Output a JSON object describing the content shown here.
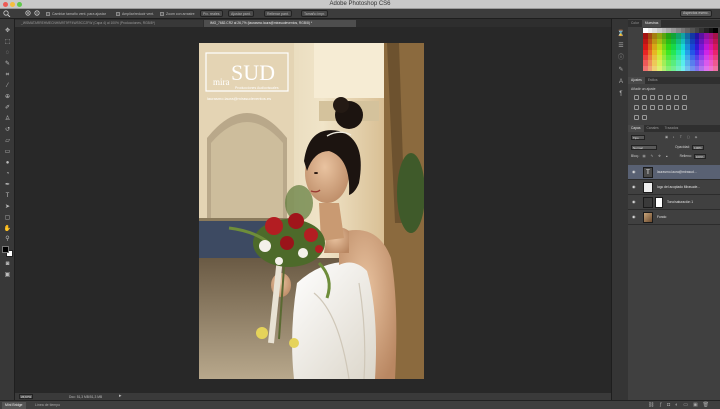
{
  "app": {
    "title": "Adobe Photoshop CS6",
    "traffic_lights": [
      "#ee5b55",
      "#f5be3e",
      "#5fc84a"
    ]
  },
  "options_bar": {
    "zoom_tools": [
      "zoom-in-icon",
      "zoom-out-icon"
    ],
    "resize_windows": "Cambiar tamaño vent. para ajustar",
    "zoom_all_windows": "Ampliar/reducir vent.",
    "scrubby_zoom": "Zoom con arrastre",
    "actual_pixels": "Píx. reales",
    "fit_screen": "Ajustar pant.",
    "fill_screen": "Rellenar pant.",
    "print_size": "Tamaño impr.",
    "workspace": "Aspectos esenc."
  },
  "documents": {
    "tabs": [
      {
        "label": "_WSMATARREHMECNHIM9T9FF4WS9CC2FW (Capa 4) al 100% (Producciones, RGB/8*)",
        "active": false
      },
      {
        "label": "IMG_7682.CR2 al 26,7% (laurasmo.laura@mirasudeventos, RGB/8) *",
        "active": true
      }
    ]
  },
  "photo": {
    "logo_prefix": "mira",
    "logo_main": "SUD",
    "logo_tagline": "Producciones Audiovisuales",
    "email": "laurasmo.laura@mirasudeventos.es",
    "dominant_colors": [
      "#e6d6ba",
      "#1a1a1a",
      "#b22222",
      "#f4f0e6"
    ]
  },
  "status": {
    "zoom": "26,67%",
    "doc_size": "Doc: 51,3 MB/51,3 MB"
  },
  "bottom_tabs": [
    "Mini Bridge",
    "Línea de tiempo"
  ],
  "panels": {
    "color_tabs": [
      "Color",
      "Muestras"
    ],
    "adjust_tabs": [
      "Ajustes",
      "Estilos"
    ],
    "adjust_title": "Añadir un ajuste",
    "layer_tabs": [
      "Capas",
      "Canales",
      "Trazados"
    ],
    "filter_kind": "Tipo",
    "blend_mode": "Normal",
    "opacity_label": "Opacidad:",
    "opacity_value": "100%",
    "lock_label": "Bloq.:",
    "fill_label": "Relleno:",
    "fill_value": "100%",
    "layers": [
      {
        "name": "laurasmo.laura@mirasud...",
        "type": "text",
        "selected": true
      },
      {
        "name": "logo del acoplado Mirasude...",
        "type": "image",
        "selected": false
      },
      {
        "name": "Tono/saturación 1",
        "type": "adjustment",
        "selected": false
      },
      {
        "name": "Fondo",
        "type": "photo",
        "selected": false
      }
    ]
  }
}
